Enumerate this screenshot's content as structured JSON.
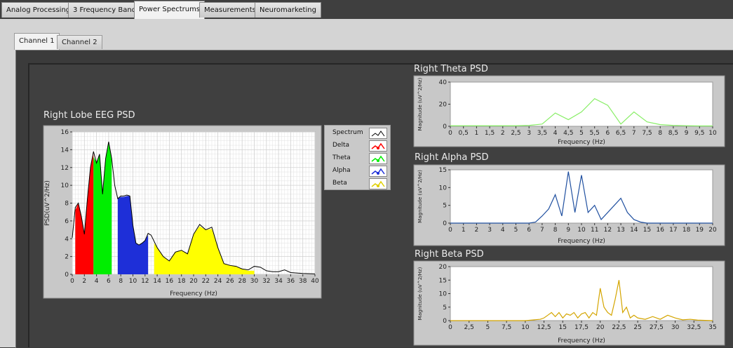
{
  "tabs": [
    "Analog Processing",
    "3 Frequency Bands",
    "Power Spectrums",
    "Measurements",
    "Neuromarketing"
  ],
  "active_tab": "Power Spectrums",
  "subtabs": [
    "Channel 1",
    "Channel 2"
  ],
  "active_subtab": "Channel 1",
  "legend": [
    {
      "label": "Spectrum",
      "color": "#000000"
    },
    {
      "label": "Delta",
      "color": "#ff0000"
    },
    {
      "label": "Theta",
      "color": "#00ee00"
    },
    {
      "label": "Alpha",
      "color": "#1e2fd8"
    },
    {
      "label": "Beta",
      "color": "#ffff00"
    }
  ],
  "chart_data": [
    {
      "id": "main",
      "type": "area",
      "title": "Right Lobe EEG PSD",
      "xlabel": "Frequency (Hz)",
      "ylabel": "PSD(uV^2/Hz)",
      "xlim": [
        0,
        40
      ],
      "ylim": [
        0,
        16
      ],
      "xticks": [
        "0",
        "2",
        "4",
        "6",
        "8",
        "10",
        "12",
        "14",
        "16",
        "18",
        "20",
        "22",
        "24",
        "26",
        "28",
        "30",
        "32",
        "34",
        "36",
        "38",
        "40"
      ],
      "yticks": [
        "0",
        "2",
        "4",
        "6",
        "8",
        "10",
        "12",
        "14",
        "16"
      ],
      "spectrum": [
        [
          0,
          4.1
        ],
        [
          0.5,
          7.5
        ],
        [
          1,
          8
        ],
        [
          1.5,
          6.5
        ],
        [
          2,
          4.5
        ],
        [
          2.5,
          8.5
        ],
        [
          3,
          12
        ],
        [
          3.5,
          13.8
        ],
        [
          4,
          12.5
        ],
        [
          4.5,
          13.5
        ],
        [
          5,
          9
        ],
        [
          5.5,
          13
        ],
        [
          6,
          14.9
        ],
        [
          6.5,
          13
        ],
        [
          7,
          10
        ],
        [
          7.5,
          8.5
        ],
        [
          8,
          8.8
        ],
        [
          8.5,
          8.8
        ],
        [
          9,
          8.9
        ],
        [
          9.5,
          8.8
        ],
        [
          10,
          5.5
        ],
        [
          10.5,
          3.5
        ],
        [
          11,
          3.3
        ],
        [
          11.5,
          3.5
        ],
        [
          12,
          3.8
        ],
        [
          12.5,
          4.6
        ],
        [
          13,
          4.4
        ],
        [
          14,
          3
        ],
        [
          15,
          2
        ],
        [
          16,
          1.5
        ],
        [
          17,
          2.5
        ],
        [
          18,
          2.7
        ],
        [
          19,
          2.3
        ],
        [
          20,
          4.5
        ],
        [
          21,
          5.6
        ],
        [
          22,
          5
        ],
        [
          23,
          5.3
        ],
        [
          24,
          3
        ],
        [
          25,
          1.2
        ],
        [
          26,
          1.0
        ],
        [
          27,
          0.9
        ],
        [
          28,
          0.6
        ],
        [
          29,
          0.5
        ],
        [
          30,
          0.9
        ],
        [
          31,
          0.8
        ],
        [
          32,
          0.4
        ],
        [
          33,
          0.3
        ],
        [
          34,
          0.3
        ],
        [
          35,
          0.5
        ],
        [
          36,
          0.2
        ],
        [
          37,
          0.15
        ],
        [
          38,
          0.1
        ],
        [
          40,
          0.05
        ]
      ],
      "bands": [
        {
          "name": "Delta",
          "color": "#ff0000",
          "points": [
            [
              0.5,
              7.2
            ],
            [
              1,
              8
            ],
            [
              1.5,
              6.5
            ],
            [
              2,
              4.5
            ],
            [
              2.5,
              8.5
            ],
            [
              3,
              12
            ],
            [
              3.5,
              13.5
            ]
          ]
        },
        {
          "name": "Theta",
          "color": "#00ee00",
          "points": [
            [
              3.5,
              13.2
            ],
            [
              4,
              12.5
            ],
            [
              4.5,
              13.5
            ],
            [
              5,
              9
            ],
            [
              5.5,
              13
            ],
            [
              6,
              14.7
            ],
            [
              6.5,
              13
            ]
          ]
        },
        {
          "name": "Alpha",
          "color": "#1e2fd8",
          "points": [
            [
              7.5,
              8.5
            ],
            [
              8,
              8.7
            ],
            [
              8.5,
              8.7
            ],
            [
              9,
              8.8
            ],
            [
              9.5,
              8.8
            ],
            [
              10,
              5.5
            ],
            [
              10.5,
              3.5
            ],
            [
              11,
              3.3
            ],
            [
              11.5,
              3.5
            ],
            [
              12,
              3.8
            ],
            [
              12.5,
              4.4
            ]
          ]
        },
        {
          "name": "Beta",
          "color": "#ffff00",
          "points": [
            [
              13.5,
              3.5
            ],
            [
              14,
              3
            ],
            [
              15,
              2
            ],
            [
              16,
              1.5
            ],
            [
              17,
              2.5
            ],
            [
              18,
              2.7
            ],
            [
              19,
              2.3
            ],
            [
              20,
              4.5
            ],
            [
              21,
              5.4
            ],
            [
              22,
              5
            ],
            [
              23,
              5.1
            ],
            [
              24,
              3
            ],
            [
              25,
              1.2
            ],
            [
              26,
              1.0
            ],
            [
              27,
              0.9
            ],
            [
              28,
              0.6
            ],
            [
              29,
              0.4
            ],
            [
              30,
              0.4
            ]
          ]
        }
      ]
    },
    {
      "id": "theta",
      "type": "line",
      "title": "Right Theta PSD",
      "xlabel": "Frequency (Hz)",
      "ylabel": "Magnitude (uV^2/Hz)",
      "xlim": [
        0,
        10
      ],
      "ylim": [
        0,
        40
      ],
      "xticks": [
        "0",
        "0,5",
        "1",
        "1,5",
        "2",
        "2,5",
        "3",
        "3,5",
        "4",
        "4,5",
        "5",
        "5,5",
        "6",
        "6,5",
        "7",
        "7,5",
        "8",
        "8,5",
        "9",
        "9,5",
        "10"
      ],
      "yticks": [
        "0",
        "20",
        "40"
      ],
      "color": "#88ee66",
      "x": [
        0,
        0.5,
        1,
        1.5,
        2,
        2.5,
        3,
        3.5,
        4,
        4.5,
        5,
        5.5,
        6,
        6.5,
        7,
        7.5,
        8,
        8.5,
        9,
        9.5,
        10
      ],
      "y": [
        0.5,
        0.5,
        0.5,
        0.5,
        0.5,
        0.5,
        0.8,
        2,
        12,
        6,
        13,
        25,
        19,
        2,
        13,
        4,
        1.5,
        0.8,
        0.5,
        0.3,
        0.3
      ]
    },
    {
      "id": "alpha",
      "type": "line",
      "title": "Right Alpha PSD",
      "xlabel": "Frequency (Hz)",
      "ylabel": "Magnitude (uV^2/Hz)",
      "xlim": [
        0,
        20
      ],
      "ylim": [
        0,
        15
      ],
      "xticks": [
        "0",
        "1",
        "2",
        "3",
        "4",
        "5",
        "6",
        "7",
        "8",
        "9",
        "10",
        "11",
        "12",
        "13",
        "14",
        "15",
        "16",
        "17",
        "18",
        "19",
        "20"
      ],
      "yticks": [
        "0",
        "5",
        "10",
        "15"
      ],
      "color": "#2050a0",
      "x": [
        0,
        1,
        2,
        3,
        4,
        5,
        6,
        6.5,
        7,
        7.5,
        8,
        8.5,
        9,
        9.5,
        10,
        10.5,
        11,
        11.5,
        12,
        12.5,
        13,
        13.5,
        14,
        14.5,
        15,
        16,
        17,
        18,
        19,
        20
      ],
      "y": [
        0,
        0,
        0,
        0,
        0,
        0,
        0,
        0.3,
        2,
        4,
        8,
        2,
        14.5,
        3,
        13.5,
        3,
        5,
        1,
        3,
        5,
        7,
        3,
        1,
        0.3,
        0,
        0,
        0,
        0,
        0,
        0
      ]
    },
    {
      "id": "beta",
      "type": "line",
      "title": "Right Beta PSD",
      "xlabel": "Frequency (Hz)",
      "ylabel": "Magnitude (uV^2/Hz)",
      "xlim": [
        0,
        35
      ],
      "ylim": [
        0,
        20
      ],
      "xticks": [
        "0",
        "2,5",
        "5",
        "7,5",
        "10",
        "12,5",
        "15",
        "17,5",
        "20",
        "22,5",
        "25",
        "27,5",
        "30",
        "32,5",
        "35"
      ],
      "yticks": [
        "0",
        "5",
        "10",
        "15",
        "20"
      ],
      "color": "#d4a500",
      "x": [
        0,
        10,
        12,
        12.5,
        13,
        13.5,
        14,
        14.5,
        15,
        15.5,
        16,
        16.5,
        17,
        17.5,
        18,
        18.5,
        19,
        19.5,
        20,
        20.5,
        21,
        21.5,
        22,
        22.5,
        23,
        23.5,
        24,
        24.5,
        25,
        26,
        27,
        28,
        29,
        30,
        31,
        32,
        33,
        35
      ],
      "y": [
        0,
        0,
        0.5,
        1,
        2,
        3,
        1.5,
        3,
        1,
        2.5,
        2,
        3,
        1,
        2.5,
        3,
        1,
        3,
        2,
        12,
        5,
        3,
        2,
        8,
        15,
        3,
        5,
        1,
        2,
        1,
        0.5,
        1.5,
        0.5,
        2,
        1,
        0.3,
        0.5,
        0.2,
        0
      ]
    }
  ]
}
